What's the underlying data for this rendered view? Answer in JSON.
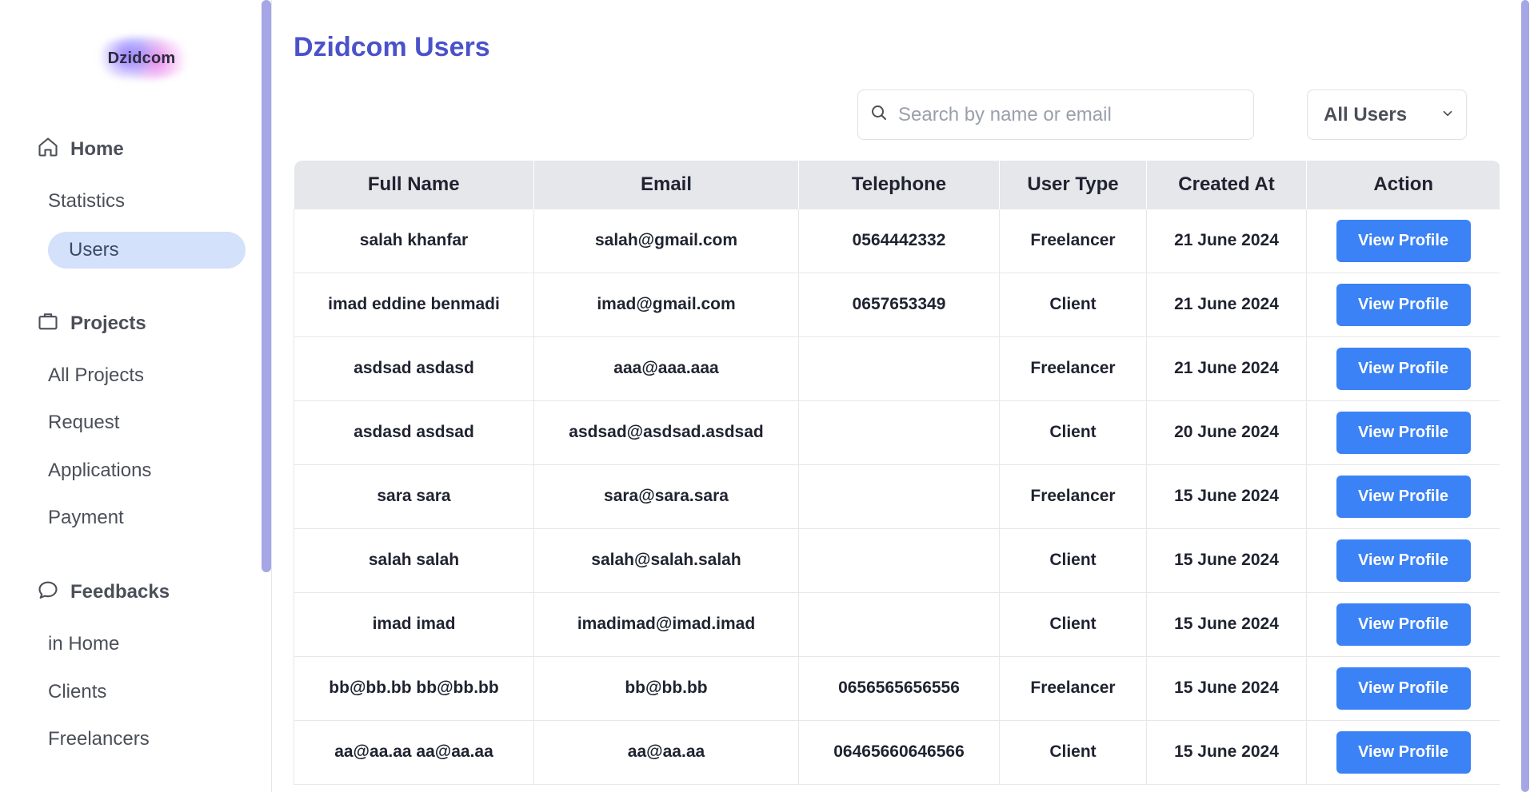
{
  "sidebar": {
    "logo_text": "Dzidcom",
    "sections": {
      "home": {
        "label": "Home",
        "items": [
          "Statistics",
          "Users"
        ]
      },
      "projects": {
        "label": "Projects",
        "items": [
          "All Projects",
          "Request",
          "Applications",
          "Payment"
        ]
      },
      "feedbacks": {
        "label": "Feedbacks",
        "items": [
          "in Home",
          "Clients",
          "Freelancers"
        ]
      }
    },
    "active_item": "Users"
  },
  "page": {
    "title": "Dzidcom Users"
  },
  "search": {
    "placeholder": "Search by name or email",
    "value": ""
  },
  "filter": {
    "selected": "All Users"
  },
  "table": {
    "headers": [
      "Full Name",
      "Email",
      "Telephone",
      "User Type",
      "Created At",
      "Action"
    ],
    "rows": [
      {
        "name": "salah khanfar",
        "email": "salah@gmail.com",
        "phone": "0564442332",
        "type": "Freelancer",
        "created": "21 June 2024",
        "action": "View Profile"
      },
      {
        "name": "imad eddine benmadi",
        "email": "imad@gmail.com",
        "phone": "0657653349",
        "type": "Client",
        "created": "21 June 2024",
        "action": "View Profile"
      },
      {
        "name": "asdsad asdasd",
        "email": "aaa@aaa.aaa",
        "phone": "",
        "type": "Freelancer",
        "created": "21 June 2024",
        "action": "View Profile"
      },
      {
        "name": "asdasd asdsad",
        "email": "asdsad@asdsad.asdsad",
        "phone": "",
        "type": "Client",
        "created": "20 June 2024",
        "action": "View Profile"
      },
      {
        "name": "sara sara",
        "email": "sara@sara.sara",
        "phone": "",
        "type": "Freelancer",
        "created": "15 June 2024",
        "action": "View Profile"
      },
      {
        "name": "salah salah",
        "email": "salah@salah.salah",
        "phone": "",
        "type": "Client",
        "created": "15 June 2024",
        "action": "View Profile"
      },
      {
        "name": "imad imad",
        "email": "imadimad@imad.imad",
        "phone": "",
        "type": "Client",
        "created": "15 June 2024",
        "action": "View Profile"
      },
      {
        "name": "bb@bb.bb bb@bb.bb",
        "email": "bb@bb.bb",
        "phone": "0656565656556",
        "type": "Freelancer",
        "created": "15 June 2024",
        "action": "View Profile"
      },
      {
        "name": "aa@aa.aa aa@aa.aa",
        "email": "aa@aa.aa",
        "phone": "06465660646566",
        "type": "Client",
        "created": "15 June 2024",
        "action": "View Profile"
      }
    ]
  },
  "icons": {
    "home": "home-icon",
    "projects": "briefcase-icon",
    "feedbacks": "chat-bubble-icon",
    "search": "search-icon",
    "dropdown": "chevron-down-icon"
  },
  "colors": {
    "accent_title": "#4b52c9",
    "button": "#3b82f6",
    "active_nav": "#d3e1fb",
    "scrollbar": "#a5a6e6",
    "table_header": "#e5e7eb"
  }
}
